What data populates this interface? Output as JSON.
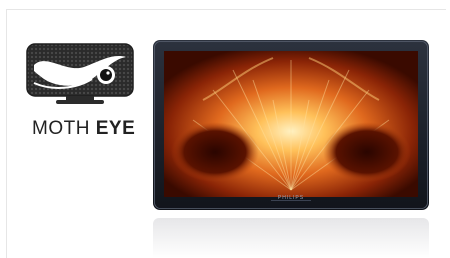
{
  "brand": {
    "name_light": "MOTH ",
    "name_bold": "EYE",
    "logo_icon": "monitor-eye-icon"
  },
  "tv": {
    "manufacturer": "PHILIPS",
    "screen_image": "moth-face-closeup"
  },
  "colors": {
    "logo_dark": "#2b2b2b",
    "tv_bezel": "#1a1f2a",
    "screen_hot": "#ffd27a",
    "screen_mid": "#d2541a",
    "screen_dark": "#3a0a00"
  }
}
